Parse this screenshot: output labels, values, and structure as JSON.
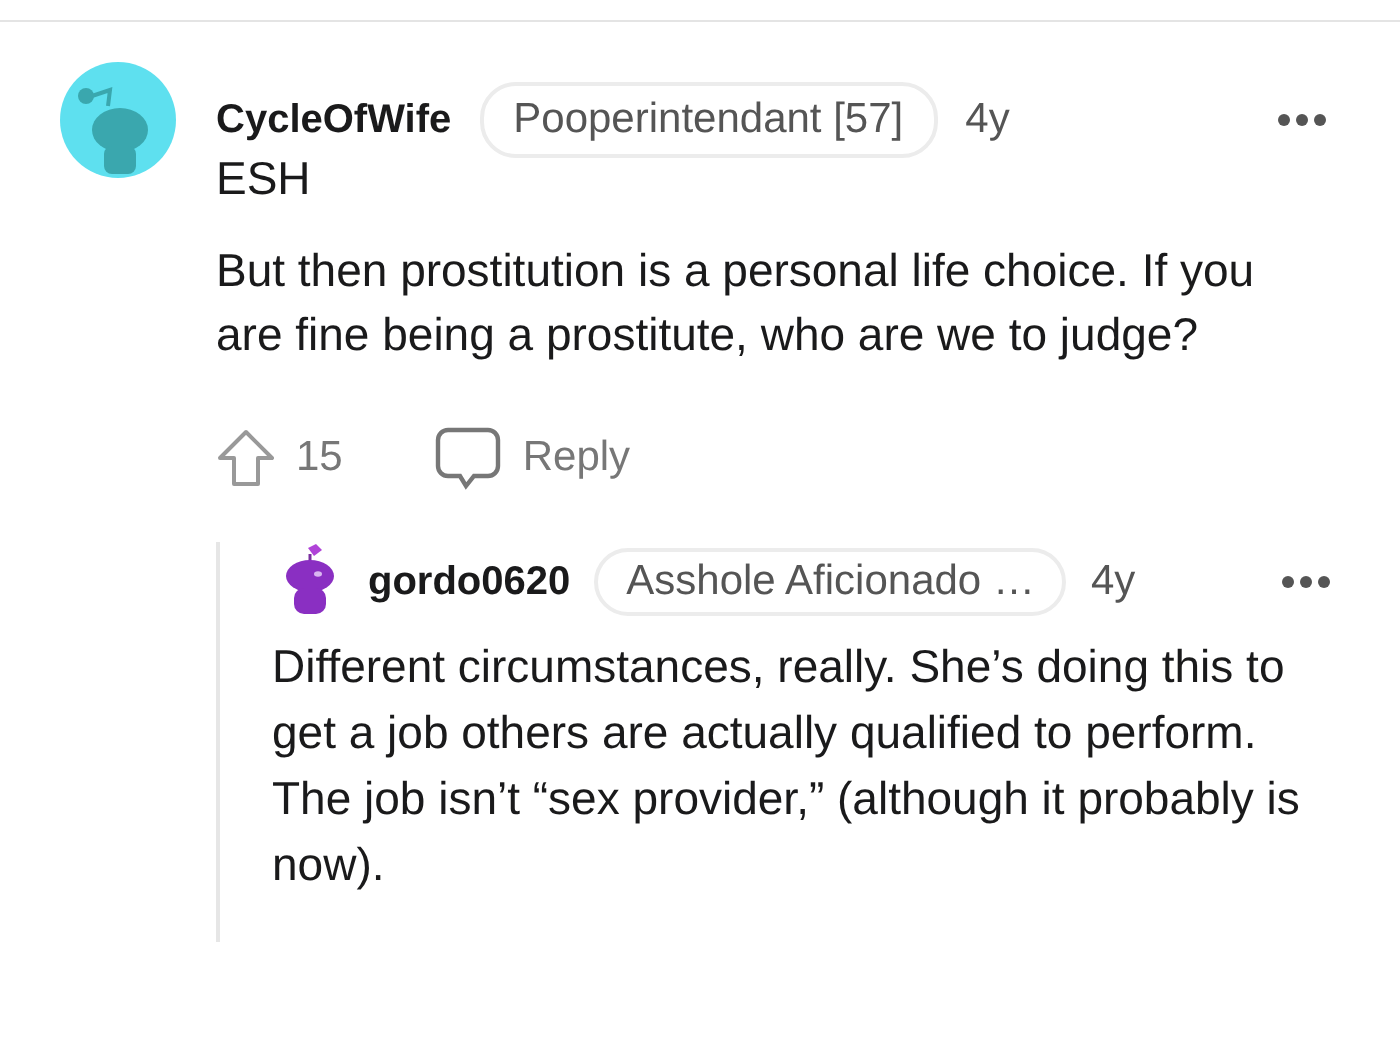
{
  "comment": {
    "author": "CycleOfWife",
    "kind": "circle",
    "flair": "Pooperintendant [57]",
    "age": "4y",
    "body": [
      "ESH",
      "But then prostitution is a personal life choice. If you are fine being a prostitute, who are we to judge?"
    ],
    "votes": "15",
    "reply_label": "Reply",
    "replies": [
      {
        "author": "gordo0620",
        "kind": "figure",
        "flair": "Asshole Aficionado …",
        "age": "4y",
        "body": [
          "Different circumstances, really. She’s doing this to get a job others are actually qualified to perform. The job isn’t “sex provider,” (although it probably is now)."
        ]
      }
    ]
  }
}
